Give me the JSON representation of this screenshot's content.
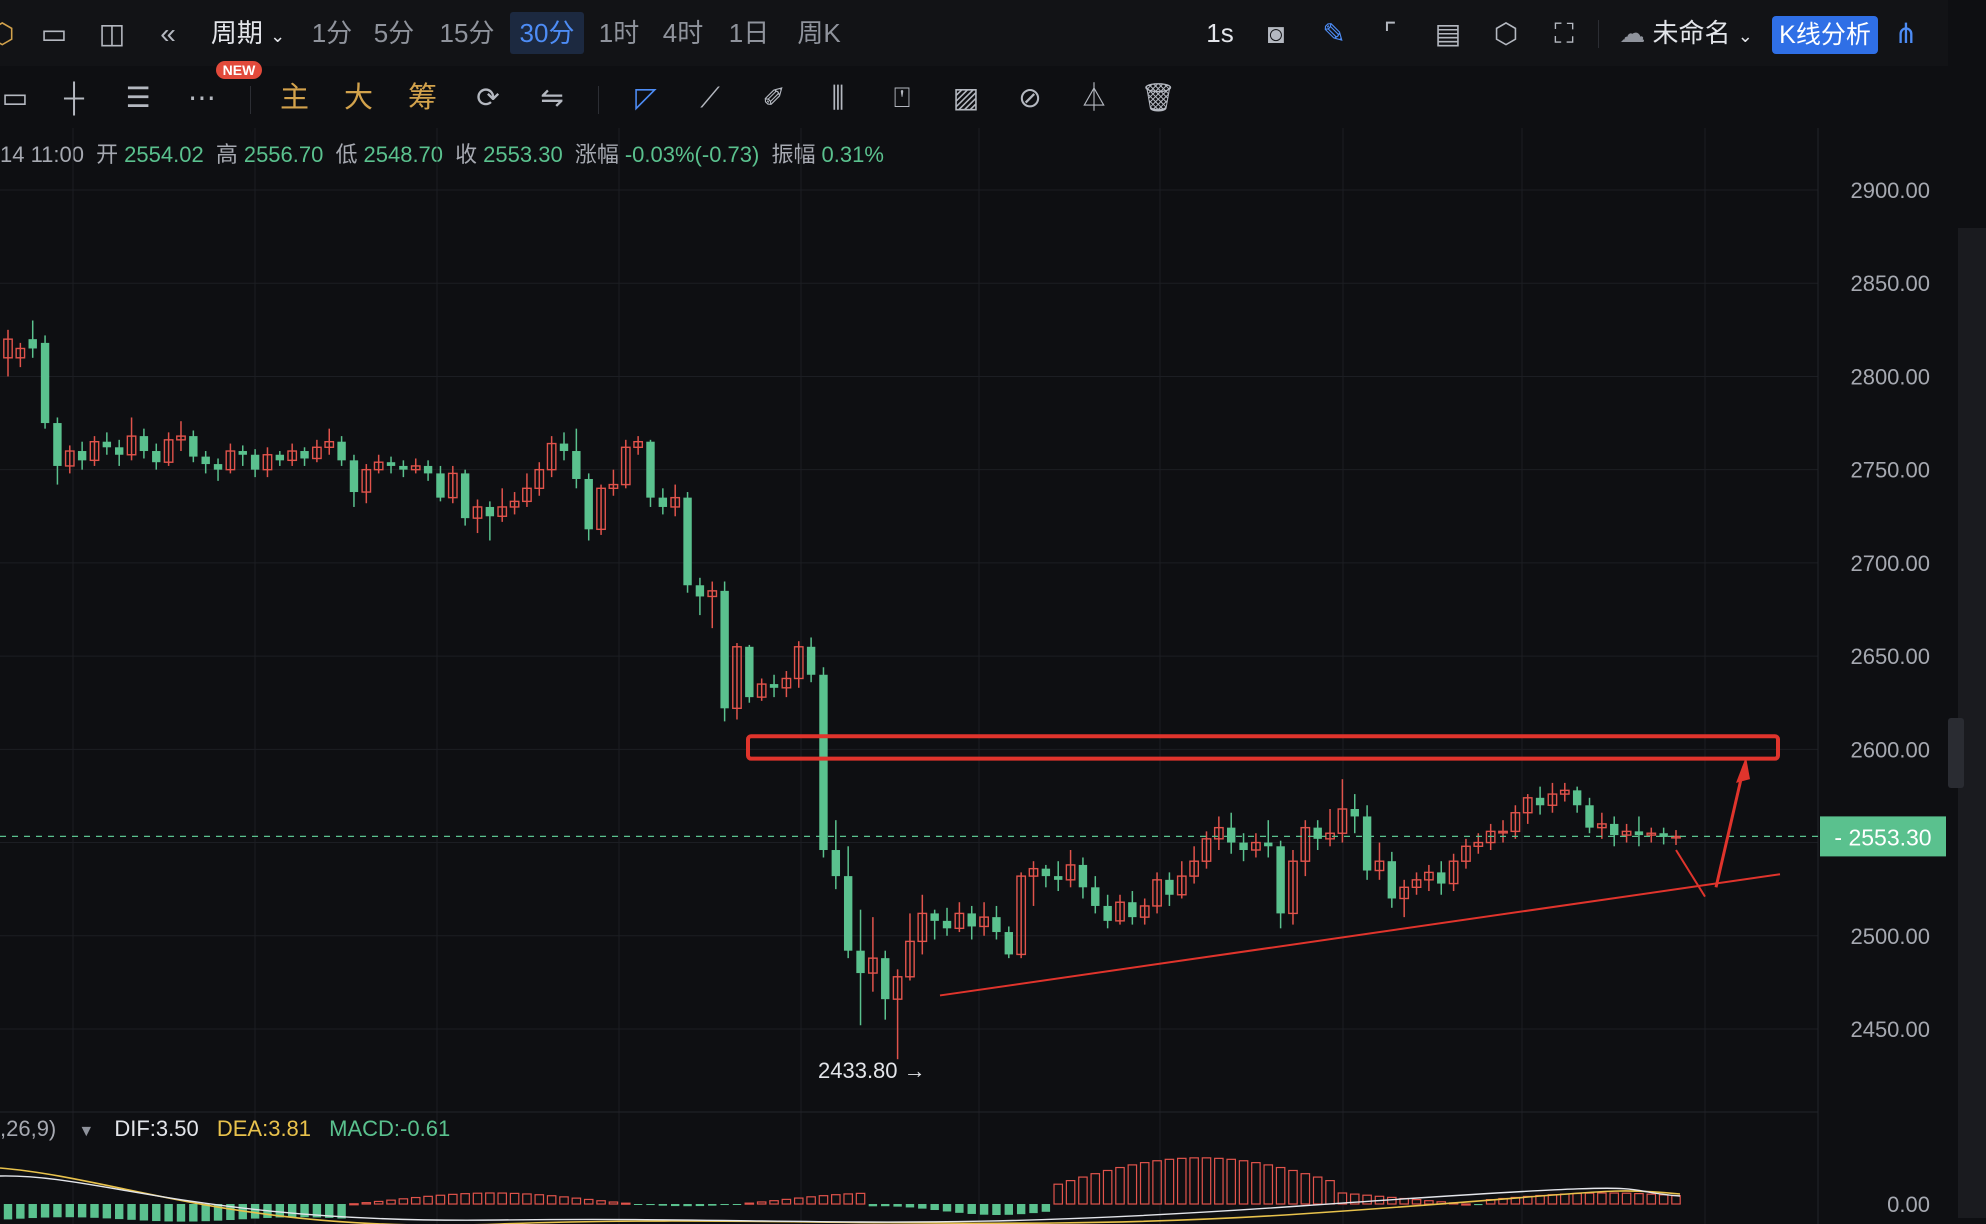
{
  "topbar": {
    "period_label": "周期",
    "intervals": [
      "1分",
      "5分",
      "15分",
      "30分",
      "1时",
      "4时",
      "1日",
      "周K"
    ],
    "active_interval": "30分",
    "speed": "1s",
    "layout_name": "未命名",
    "analysis_button": "K线分析"
  },
  "toolbar": {
    "new_badge": "NEW",
    "indicators": [
      "主",
      "大",
      "筹"
    ]
  },
  "info_bar": {
    "time": "14 11:00",
    "open_label": "开",
    "open": "2554.02",
    "high_label": "高",
    "high": "2556.70",
    "low_label": "低",
    "low": "2548.70",
    "close_label": "收",
    "close": "2553.30",
    "change_label": "涨幅",
    "change": "-0.03%(-0.73)",
    "amplitude_label": "振幅",
    "amplitude": "0.31%"
  },
  "macd": {
    "params": ",26,9)",
    "dif_label": "DIF:3.50",
    "dea_label": "DEA:3.81",
    "macd_label": "MACD:-0.61"
  },
  "colors": {
    "up": "#e0534b",
    "down": "#5ac18e",
    "accent": "#4d8cf5",
    "background": "#0e0f12"
  },
  "chart_data": {
    "type": "candlestick",
    "ylim": [
      2410,
      2925
    ],
    "y_ticks": [
      "2900.00",
      "2850.00",
      "2800.00",
      "2750.00",
      "2700.00",
      "2650.00",
      "2600.00",
      "2500.00",
      "2450.00"
    ],
    "last_price": "2553.30",
    "low_marker": "2433.80",
    "macd_zero_label": "0.00",
    "candles": [
      [
        2810,
        2820,
        2800,
        2825
      ],
      [
        2810,
        2815,
        2805,
        2818
      ],
      [
        2820,
        2815,
        2810,
        2830
      ],
      [
        2818,
        2775,
        2772,
        2822
      ],
      [
        2775,
        2752,
        2742,
        2778
      ],
      [
        2752,
        2760,
        2748,
        2763
      ],
      [
        2760,
        2755,
        2750,
        2765
      ],
      [
        2755,
        2765,
        2752,
        2768
      ],
      [
        2765,
        2762,
        2758,
        2770
      ],
      [
        2762,
        2758,
        2752,
        2766
      ],
      [
        2758,
        2768,
        2755,
        2778
      ],
      [
        2768,
        2760,
        2756,
        2772
      ],
      [
        2760,
        2754,
        2750,
        2764
      ],
      [
        2754,
        2766,
        2752,
        2770
      ],
      [
        2766,
        2768,
        2760,
        2776
      ],
      [
        2768,
        2757,
        2754,
        2771
      ],
      [
        2757,
        2753,
        2748,
        2760
      ],
      [
        2753,
        2750,
        2744,
        2756
      ],
      [
        2750,
        2760,
        2748,
        2764
      ],
      [
        2760,
        2758,
        2752,
        2763
      ],
      [
        2758,
        2750,
        2746,
        2761
      ],
      [
        2750,
        2758,
        2746,
        2762
      ],
      [
        2758,
        2755,
        2752,
        2760
      ],
      [
        2755,
        2760,
        2752,
        2764
      ],
      [
        2760,
        2756,
        2752,
        2762
      ],
      [
        2756,
        2762,
        2754,
        2766
      ],
      [
        2762,
        2765,
        2758,
        2772
      ],
      [
        2765,
        2755,
        2752,
        2768
      ],
      [
        2755,
        2738,
        2730,
        2758
      ],
      [
        2738,
        2750,
        2732,
        2753
      ],
      [
        2750,
        2754,
        2748,
        2758
      ],
      [
        2754,
        2752,
        2748,
        2757
      ],
      [
        2752,
        2750,
        2746,
        2755
      ],
      [
        2750,
        2752,
        2748,
        2756
      ],
      [
        2752,
        2748,
        2744,
        2755
      ],
      [
        2748,
        2735,
        2733,
        2752
      ],
      [
        2735,
        2748,
        2732,
        2752
      ],
      [
        2748,
        2724,
        2720,
        2750
      ],
      [
        2724,
        2730,
        2716,
        2734
      ],
      [
        2730,
        2725,
        2712,
        2733
      ],
      [
        2725,
        2730,
        2722,
        2740
      ],
      [
        2730,
        2733,
        2726,
        2738
      ],
      [
        2733,
        2740,
        2730,
        2748
      ],
      [
        2740,
        2750,
        2736,
        2754
      ],
      [
        2750,
        2764,
        2746,
        2768
      ],
      [
        2764,
        2760,
        2755,
        2770
      ],
      [
        2760,
        2745,
        2740,
        2772
      ],
      [
        2745,
        2718,
        2712,
        2748
      ],
      [
        2718,
        2740,
        2715,
        2742
      ],
      [
        2740,
        2742,
        2736,
        2750
      ],
      [
        2742,
        2762,
        2740,
        2766
      ],
      [
        2762,
        2765,
        2758,
        2768
      ],
      [
        2765,
        2735,
        2730,
        2766
      ],
      [
        2735,
        2730,
        2726,
        2740
      ],
      [
        2730,
        2735,
        2725,
        2742
      ],
      [
        2735,
        2688,
        2684,
        2738
      ],
      [
        2688,
        2682,
        2672,
        2692
      ],
      [
        2682,
        2685,
        2665,
        2690
      ],
      [
        2685,
        2622,
        2615,
        2690
      ],
      [
        2622,
        2655,
        2616,
        2657
      ],
      [
        2655,
        2628,
        2625,
        2656
      ],
      [
        2628,
        2635,
        2626,
        2638
      ],
      [
        2635,
        2633,
        2628,
        2640
      ],
      [
        2633,
        2638,
        2628,
        2642
      ],
      [
        2638,
        2655,
        2633,
        2658
      ],
      [
        2655,
        2640,
        2636,
        2660
      ],
      [
        2640,
        2546,
        2542,
        2644
      ],
      [
        2546,
        2532,
        2525,
        2562
      ],
      [
        2532,
        2492,
        2488,
        2548
      ],
      [
        2492,
        2480,
        2452,
        2514
      ],
      [
        2480,
        2488,
        2470,
        2510
      ],
      [
        2488,
        2466,
        2455,
        2492
      ],
      [
        2466,
        2478,
        2433.8,
        2482
      ],
      [
        2478,
        2497,
        2476,
        2512
      ],
      [
        2497,
        2512,
        2490,
        2522
      ],
      [
        2512,
        2508,
        2498,
        2514
      ],
      [
        2508,
        2504,
        2500,
        2515
      ],
      [
        2504,
        2512,
        2502,
        2518
      ],
      [
        2512,
        2505,
        2498,
        2516
      ],
      [
        2505,
        2510,
        2500,
        2518
      ],
      [
        2510,
        2502,
        2498,
        2516
      ],
      [
        2502,
        2490,
        2488,
        2505
      ],
      [
        2490,
        2532,
        2488,
        2534
      ],
      [
        2532,
        2536,
        2516,
        2540
      ],
      [
        2536,
        2532,
        2526,
        2538
      ],
      [
        2532,
        2530,
        2524,
        2540
      ],
      [
        2530,
        2538,
        2526,
        2546
      ],
      [
        2538,
        2526,
        2520,
        2542
      ],
      [
        2526,
        2516,
        2512,
        2532
      ],
      [
        2516,
        2508,
        2504,
        2522
      ],
      [
        2508,
        2518,
        2506,
        2522
      ],
      [
        2518,
        2510,
        2506,
        2524
      ],
      [
        2510,
        2516,
        2506,
        2520
      ],
      [
        2516,
        2530,
        2512,
        2534
      ],
      [
        2530,
        2522,
        2516,
        2534
      ],
      [
        2522,
        2532,
        2520,
        2540
      ],
      [
        2532,
        2540,
        2528,
        2548
      ],
      [
        2540,
        2552,
        2536,
        2556
      ],
      [
        2552,
        2558,
        2546,
        2564
      ],
      [
        2558,
        2550,
        2544,
        2566
      ],
      [
        2550,
        2546,
        2540,
        2555
      ],
      [
        2546,
        2550,
        2542,
        2555
      ],
      [
        2550,
        2548,
        2542,
        2562
      ],
      [
        2548,
        2512,
        2504,
        2551
      ],
      [
        2512,
        2540,
        2506,
        2546
      ],
      [
        2540,
        2558,
        2532,
        2562
      ],
      [
        2558,
        2552,
        2546,
        2562
      ],
      [
        2552,
        2555,
        2548,
        2568
      ],
      [
        2555,
        2568,
        2550,
        2584
      ],
      [
        2568,
        2564,
        2555,
        2576
      ],
      [
        2564,
        2535,
        2530,
        2570
      ],
      [
        2535,
        2540,
        2530,
        2550
      ],
      [
        2540,
        2520,
        2515,
        2545
      ],
      [
        2520,
        2526,
        2510,
        2530
      ],
      [
        2526,
        2530,
        2522,
        2534
      ],
      [
        2530,
        2534,
        2524,
        2538
      ],
      [
        2534,
        2528,
        2522,
        2540
      ],
      [
        2528,
        2540,
        2524,
        2544
      ],
      [
        2540,
        2548,
        2536,
        2552
      ],
      [
        2548,
        2550,
        2544,
        2555
      ],
      [
        2550,
        2556,
        2546,
        2560
      ],
      [
        2556,
        2556,
        2550,
        2562
      ],
      [
        2556,
        2566,
        2552,
        2570
      ],
      [
        2566,
        2574,
        2560,
        2576
      ],
      [
        2574,
        2570,
        2565,
        2580
      ],
      [
        2570,
        2576,
        2566,
        2582
      ],
      [
        2576,
        2578,
        2572,
        2582
      ],
      [
        2578,
        2570,
        2566,
        2580
      ],
      [
        2570,
        2558,
        2555,
        2574
      ],
      [
        2558,
        2560,
        2552,
        2566
      ],
      [
        2560,
        2554,
        2548,
        2564
      ],
      [
        2554,
        2556,
        2550,
        2560
      ],
      [
        2556,
        2554,
        2548,
        2564
      ],
      [
        2554,
        2555,
        2550,
        2558
      ],
      [
        2555,
        2553,
        2549,
        2558
      ],
      [
        2553,
        2553.3,
        2548.7,
        2556.7
      ]
    ]
  }
}
